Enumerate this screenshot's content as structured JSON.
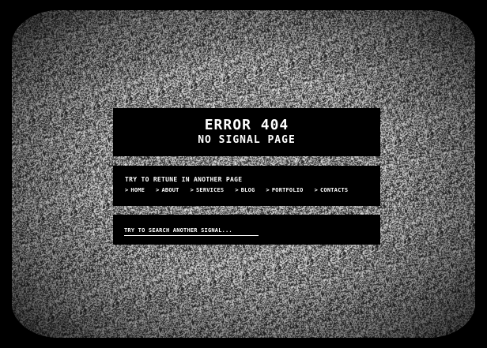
{
  "error": {
    "title": "ERROR 404",
    "subtitle": "NO SIGNAL PAGE"
  },
  "nav": {
    "heading": "TRY TO RETUNE IN ANOTHER PAGE",
    "chevron": ">",
    "items": [
      {
        "label": "HOME"
      },
      {
        "label": "ABOUT"
      },
      {
        "label": "SERVICES"
      },
      {
        "label": "BLOG"
      },
      {
        "label": "PORTFOLIO"
      },
      {
        "label": "CONTACTS"
      }
    ]
  },
  "search": {
    "placeholder": "TRY TO SEARCH ANOTHER SIGNAL..."
  },
  "colors": {
    "background": "#000000",
    "panel": "#000000",
    "text": "#ffffff",
    "static_noise": "grey"
  }
}
